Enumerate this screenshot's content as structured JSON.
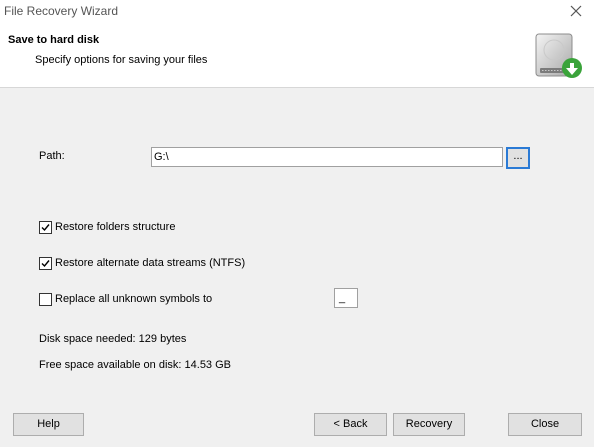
{
  "window": {
    "title": "File Recovery Wizard"
  },
  "header": {
    "title": "Save to hard disk",
    "subtitle": "Specify options for saving your files",
    "icon": "hard-disk-green-arrow-icon"
  },
  "form": {
    "path_label": "Path:",
    "path_value": "G:\\",
    "browse_label": "...",
    "restore_folders_label": "Restore folders structure",
    "restore_folders_checked": true,
    "restore_streams_label": "Restore alternate data streams (NTFS)",
    "restore_streams_checked": true,
    "replace_symbols_label": "Replace all unknown symbols to",
    "replace_symbols_checked": false,
    "replace_symbol_value": "_",
    "disk_space_needed": "Disk space needed: 129 bytes",
    "free_space": "Free space available on disk: 14.53 GB"
  },
  "buttons": {
    "help": "Help",
    "back": "< Back",
    "recovery": "Recovery",
    "close": "Close"
  },
  "colors": {
    "accent": "#2a7ad5",
    "icon_green": "#3aa33a"
  }
}
